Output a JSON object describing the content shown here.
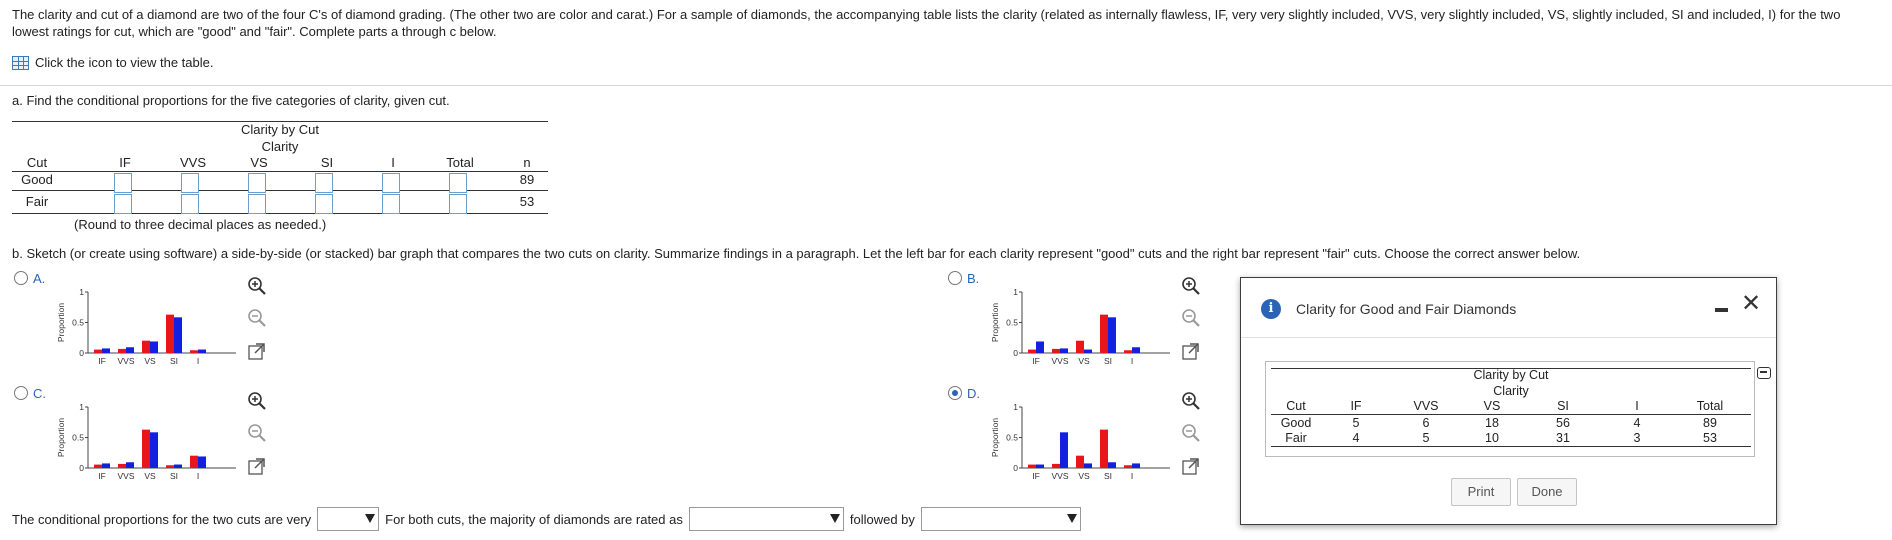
{
  "intro": "The clarity and cut of a diamond are two of the four C's of diamond grading. (The other two are color and carat.) For a sample of diamonds, the accompanying table lists the clarity (related as internally flawless, IF, very very slightly included, VVS, very slightly included, VS, slightly included, SI and included, I) for the two lowest ratings for cut, which are \"good\" and \"fair\". Complete parts a through c below.",
  "view_table": "Click the icon to view the table.",
  "part_a": "a. Find the conditional proportions for the five categories of clarity, given cut.",
  "round_note": "(Round to three decimal places as needed.)",
  "part_b": "b. Sketch (or create using software) a side-by-side (or stacked) bar graph that compares the two cuts on clarity. Summarize findings in a paragraph. Let the left bar for each clarity represent \"good\" cuts and the right bar represent \"fair\" cuts. Choose the correct answer below.",
  "cond_table": {
    "title": "Clarity by Cut",
    "subtitle": "Clarity",
    "headers": [
      "Cut",
      "IF",
      "VVS",
      "VS",
      "SI",
      "I",
      "Total",
      "n"
    ],
    "rows": [
      {
        "cut": "Good",
        "n": "89"
      },
      {
        "cut": "Fair",
        "n": "53"
      }
    ]
  },
  "options": [
    {
      "letter": "A.",
      "selected": false
    },
    {
      "letter": "B.",
      "selected": false
    },
    {
      "letter": "C.",
      "selected": false
    },
    {
      "letter": "D.",
      "selected": true
    }
  ],
  "chart_common": {
    "ylabel": "Proportion",
    "yticks": [
      "1",
      "0.5",
      "0"
    ],
    "categories": [
      "IF",
      "VVS",
      "VS",
      "SI",
      "I"
    ],
    "colors": {
      "good": "#e8151a",
      "fair": "#1420e0"
    }
  },
  "chart_data": [
    {
      "type": "bar",
      "option": "A",
      "categories": [
        "IF",
        "VVS",
        "VS",
        "SI",
        "I"
      ],
      "ylim": [
        0,
        1
      ],
      "series": [
        {
          "values": [
            0.056,
            0.067,
            0.202,
            0.629,
            0.045
          ]
        },
        {
          "values": [
            0.075,
            0.094,
            0.189,
            0.585,
            0.057
          ]
        }
      ]
    },
    {
      "type": "bar",
      "option": "B",
      "categories": [
        "IF",
        "VVS",
        "VS",
        "SI",
        "I"
      ],
      "ylim": [
        0,
        1
      ],
      "series": [
        {
          "values": [
            0.056,
            0.067,
            0.202,
            0.629,
            0.045
          ]
        },
        {
          "values": [
            0.189,
            0.075,
            0.057,
            0.585,
            0.094
          ]
        }
      ]
    },
    {
      "type": "bar",
      "option": "C",
      "categories": [
        "IF",
        "VVS",
        "VS",
        "SI",
        "I"
      ],
      "ylim": [
        0,
        1
      ],
      "series": [
        {
          "values": [
            0.056,
            0.067,
            0.629,
            0.045,
            0.202
          ]
        },
        {
          "values": [
            0.075,
            0.094,
            0.585,
            0.057,
            0.189
          ]
        }
      ]
    },
    {
      "type": "bar",
      "option": "D",
      "categories": [
        "IF",
        "VVS",
        "VS",
        "SI",
        "I"
      ],
      "ylim": [
        0,
        1
      ],
      "series": [
        {
          "values": [
            0.056,
            0.067,
            0.202,
            0.629,
            0.045
          ]
        },
        {
          "values": [
            0.057,
            0.585,
            0.075,
            0.094,
            0.075
          ]
        }
      ]
    }
  ],
  "fill": {
    "text1": "The conditional proportions for the two cuts are very",
    "text2": "For both cuts, the majority of diamonds are rated as",
    "text3": "followed by"
  },
  "popup": {
    "title": "Clarity for Good and Fair Diamonds",
    "table_title": "Clarity by Cut",
    "table_subtitle": "Clarity",
    "headers": [
      "Cut",
      "IF",
      "VVS",
      "VS",
      "SI",
      "I",
      "Total"
    ],
    "rows": [
      [
        "Good",
        "5",
        "6",
        "18",
        "56",
        "4",
        "89"
      ],
      [
        "Fair",
        "4",
        "5",
        "10",
        "31",
        "3",
        "53"
      ]
    ],
    "print_label": "Print",
    "done_label": "Done"
  }
}
